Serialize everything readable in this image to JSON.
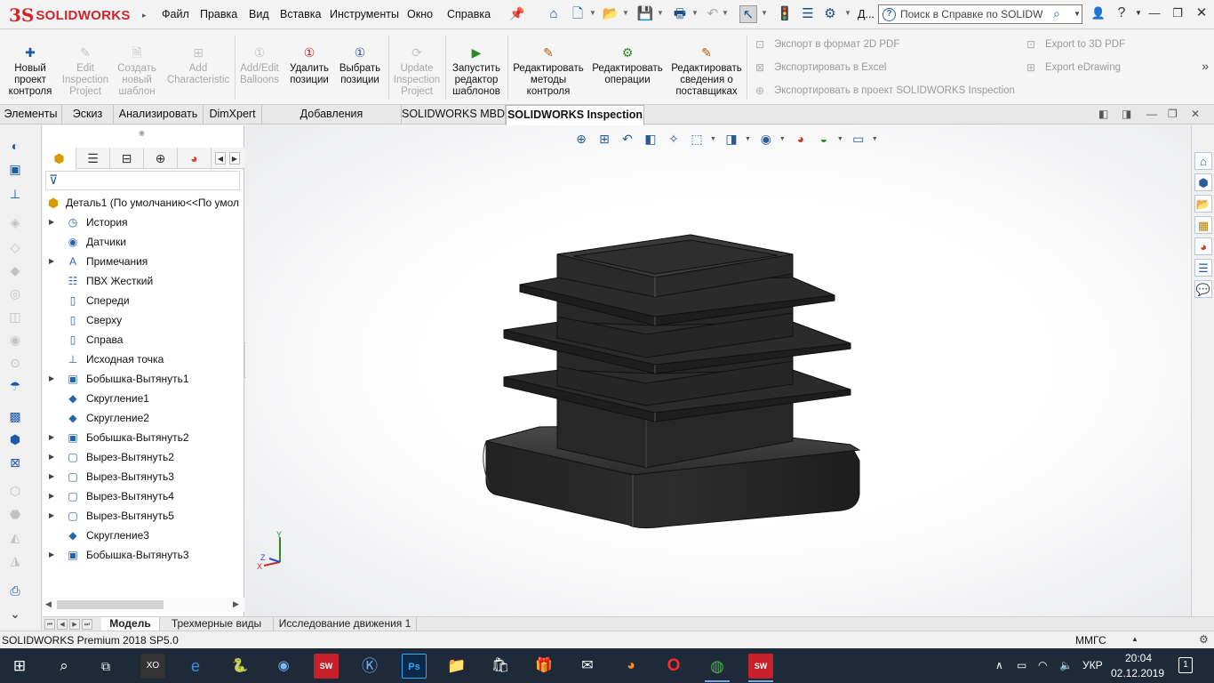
{
  "app": {
    "logo_ds": "3S",
    "logo_name": "SOLIDWORKS"
  },
  "menu": [
    "Файл",
    "Правка",
    "Вид",
    "Вставка",
    "Инструменты",
    "Окно",
    "Справка"
  ],
  "toolbar_extra_label": "Д...",
  "search": {
    "placeholder": "Поиск в Справке по SOLIDWOR",
    "value": ""
  },
  "ribbon": {
    "buttons": [
      {
        "label": "Новый проект контроля",
        "enabled": true,
        "icon": "new-project-icon"
      },
      {
        "label": "Edit Inspection Project",
        "enabled": false,
        "icon": "edit-project-icon"
      },
      {
        "label": "Создать новый шаблон",
        "enabled": false,
        "icon": "new-template-icon"
      },
      {
        "label": "Add Characteristic",
        "enabled": false,
        "icon": "add-characteristic-icon"
      },
      {
        "label": "Add/Edit Balloons",
        "enabled": false,
        "icon": "balloons-icon"
      },
      {
        "label": "Удалить позиции",
        "enabled": true,
        "icon": "delete-items-icon"
      },
      {
        "label": "Выбрать позиции",
        "enabled": true,
        "icon": "select-items-icon"
      },
      {
        "label": "Update Inspection Project",
        "enabled": false,
        "icon": "update-project-icon"
      },
      {
        "label": "Запустить редактор шаблонов",
        "enabled": true,
        "icon": "template-editor-icon"
      },
      {
        "label": "Редактировать методы контроля",
        "enabled": true,
        "icon": "edit-methods-icon"
      },
      {
        "label": "Редактировать операции",
        "enabled": true,
        "icon": "edit-operations-icon"
      },
      {
        "label": "Редактировать сведения о поставщиках",
        "enabled": true,
        "icon": "edit-vendors-icon"
      }
    ],
    "export": {
      "pdf2d": "Экспорт в формат 2D PDF",
      "excel": "Экспортировать в Excel",
      "inspection": "Экспортировать в проект SOLIDWORKS Inspection",
      "pdf3d": "Export to 3D PDF",
      "edrawing": "Export eDrawing"
    }
  },
  "command_tabs": [
    "Элементы",
    "Эскиз",
    "Анализировать",
    "DimXpert",
    "Добавления SOLIDWORKS",
    "SOLIDWORKS MBD",
    "SOLIDWORKS Inspection"
  ],
  "active_command_tab": "SOLIDWORKS Inspection",
  "tree": {
    "root": "Деталь1  (По умолчанию<<По умол",
    "items": [
      {
        "label": "История",
        "expandable": true,
        "icon": "history-icon"
      },
      {
        "label": "Датчики",
        "expandable": false,
        "icon": "sensors-icon"
      },
      {
        "label": "Примечания",
        "expandable": true,
        "icon": "annotations-icon"
      },
      {
        "label": "ПВХ Жесткий",
        "expandable": false,
        "icon": "material-icon"
      },
      {
        "label": "Спереди",
        "expandable": false,
        "icon": "plane-icon"
      },
      {
        "label": "Сверху",
        "expandable": false,
        "icon": "plane-icon"
      },
      {
        "label": "Справа",
        "expandable": false,
        "icon": "plane-icon"
      },
      {
        "label": "Исходная точка",
        "expandable": false,
        "icon": "origin-icon"
      },
      {
        "label": "Бобышка-Вытянуть1",
        "expandable": true,
        "icon": "extrude-icon"
      },
      {
        "label": "Скругление1",
        "expandable": false,
        "icon": "fillet-icon"
      },
      {
        "label": "Скругление2",
        "expandable": false,
        "icon": "fillet-icon"
      },
      {
        "label": "Бобышка-Вытянуть2",
        "expandable": true,
        "icon": "extrude-icon"
      },
      {
        "label": "Вырез-Вытянуть2",
        "expandable": true,
        "icon": "cut-icon"
      },
      {
        "label": "Вырез-Вытянуть3",
        "expandable": true,
        "icon": "cut-icon"
      },
      {
        "label": "Вырез-Вытянуть4",
        "expandable": true,
        "icon": "cut-icon"
      },
      {
        "label": "Вырез-Вытянуть5",
        "expandable": true,
        "icon": "cut-icon"
      },
      {
        "label": "Скругление3",
        "expandable": false,
        "icon": "fillet-icon"
      },
      {
        "label": "Бобышка-Вытянуть3",
        "expandable": true,
        "icon": "extrude-icon"
      }
    ]
  },
  "bottom_tabs": [
    "Модель",
    "Трехмерные виды",
    "Исследование движения 1"
  ],
  "active_bottom_tab": "Модель",
  "triad": {
    "x": "X",
    "y": "Y",
    "z": "Z"
  },
  "status": {
    "product": "SOLIDWORKS Premium 2018 SP5.0",
    "units": "ММГС"
  },
  "taskbar": {
    "lang": "УКР",
    "time": "20:04",
    "date": "02.12.2019",
    "notifications": "1"
  }
}
